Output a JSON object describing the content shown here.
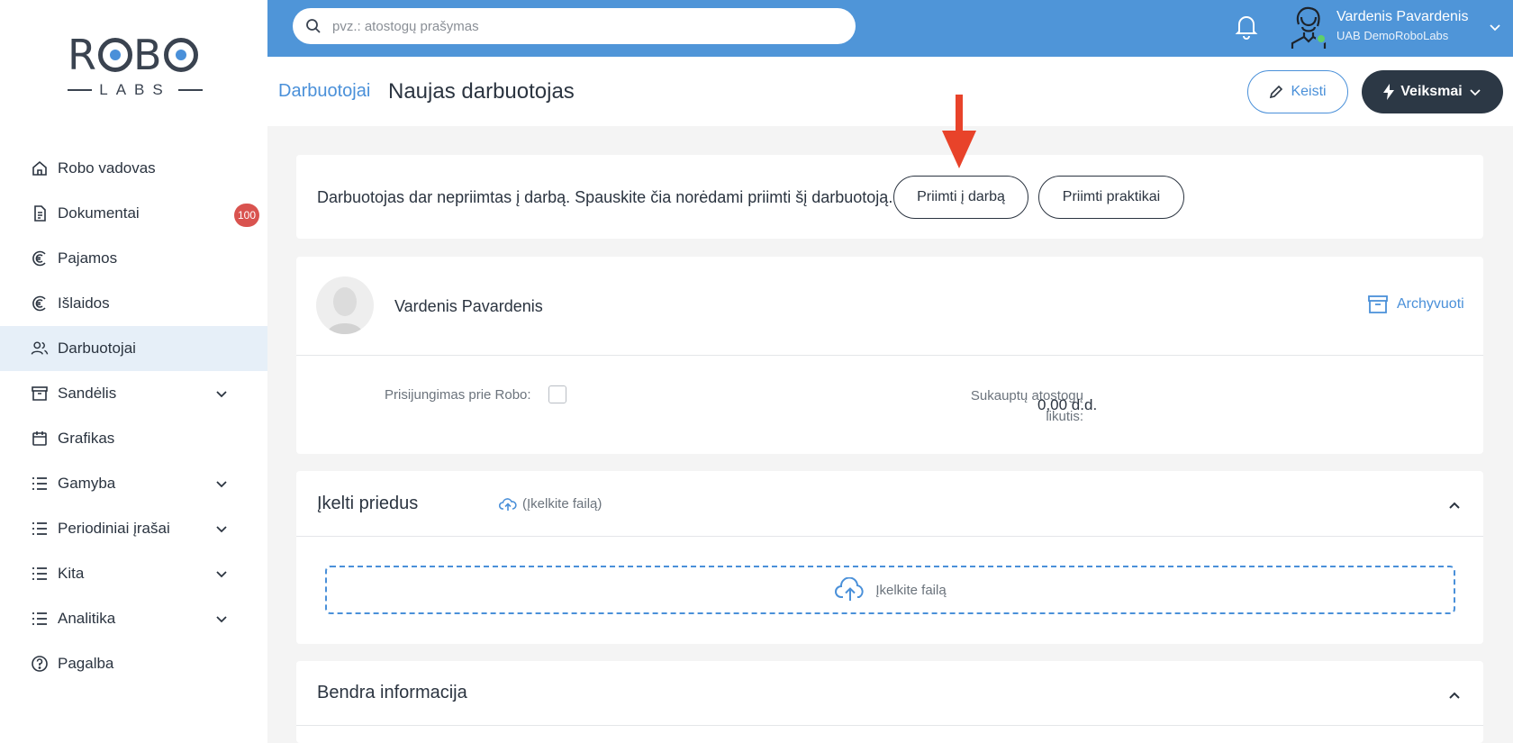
{
  "brand": {
    "word_left": "R",
    "word_mid": "B",
    "subtitle": "LABS"
  },
  "sidebar": {
    "items": [
      {
        "label": "Robo vadovas",
        "icon": "home-icon"
      },
      {
        "label": "Dokumentai",
        "icon": "document-icon",
        "badge": "100"
      },
      {
        "label": "Pajamos",
        "icon": "euro-income-icon"
      },
      {
        "label": "Išlaidos",
        "icon": "euro-expense-icon"
      },
      {
        "label": "Darbuotojai",
        "icon": "users-icon",
        "active": true
      },
      {
        "label": "Sandėlis",
        "icon": "archive-icon",
        "expandable": true
      },
      {
        "label": "Grafikas",
        "icon": "calendar-icon"
      },
      {
        "label": "Gamyba",
        "icon": "list-icon",
        "expandable": true
      },
      {
        "label": "Periodiniai įrašai",
        "icon": "list-icon",
        "expandable": true
      },
      {
        "label": "Kita",
        "icon": "list-icon",
        "expandable": true
      },
      {
        "label": "Analitika",
        "icon": "list-icon",
        "expandable": true
      },
      {
        "label": "Pagalba",
        "icon": "help-icon"
      }
    ]
  },
  "topbar": {
    "search_placeholder": "pvz.: atostogų prašymas",
    "user_name": "Vardenis Pavardenis",
    "user_company": "UAB DemoRoboLabs"
  },
  "header": {
    "breadcrumb": "Darbuotojai",
    "title": "Naujas darbuotojas",
    "edit_label": "Keisti",
    "actions_label": "Veiksmai"
  },
  "notice": {
    "text": "Darbuotojas dar nepriimtas į darbą. Spauskite čia norėdami priimti šį darbuotoją.",
    "hire_label": "Priimti į darbą",
    "intern_label": "Priimti praktikai"
  },
  "profile": {
    "name": "Vardenis Pavardenis",
    "archive_label": "Archyvuoti",
    "robo_access_label": "Prisijungimas prie Robo:",
    "robo_access_checked": false,
    "vacation_label_line1": "Sukauptų atostogų",
    "vacation_label_line2": "likutis:",
    "vacation_value": "0,00 d.d."
  },
  "attachments": {
    "heading": "Įkelti priedus",
    "upload_link": "(Įkelkite failą)",
    "dropzone_label": "Įkelkite failą"
  },
  "general": {
    "heading": "Bendra informacija"
  },
  "colors": {
    "accent": "#4f95d8",
    "dark": "#2c3845",
    "badge": "#d9534f",
    "arrow": "#e8432a"
  }
}
